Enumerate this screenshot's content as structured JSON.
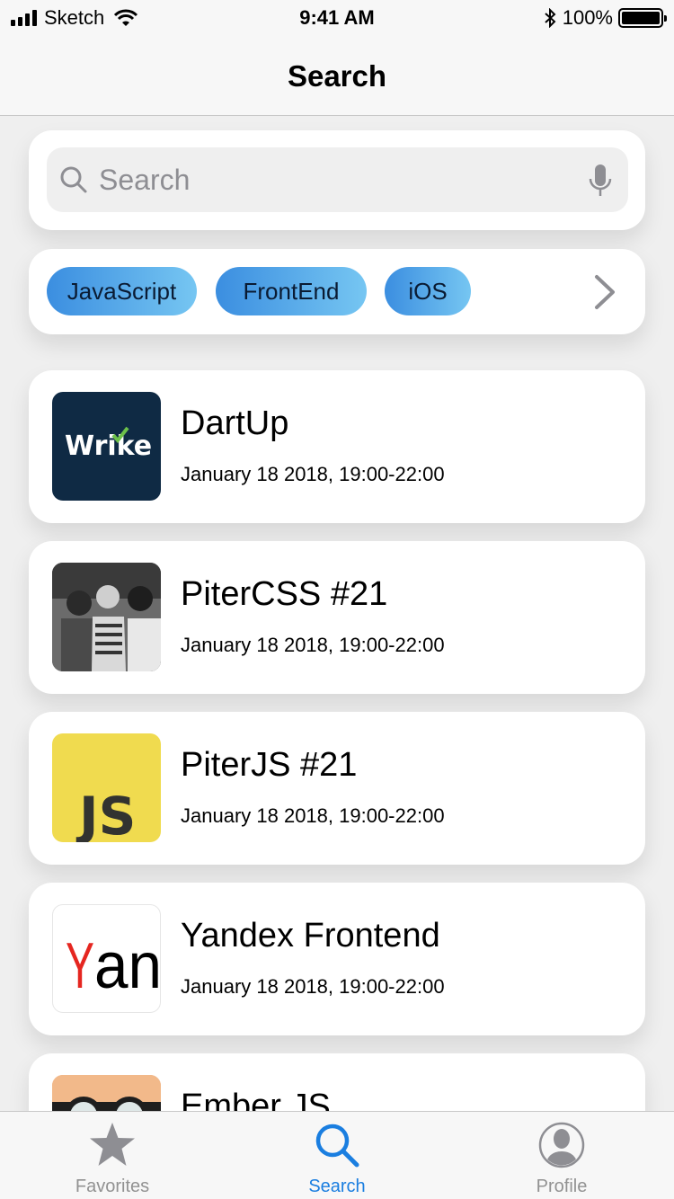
{
  "status_bar": {
    "carrier": "Sketch",
    "time": "9:41 AM",
    "battery": "100%"
  },
  "nav": {
    "title": "Search"
  },
  "search": {
    "placeholder": "Search"
  },
  "tags": [
    "JavaScript",
    "FrontEnd",
    "iOS"
  ],
  "events": [
    {
      "title": "DartUp",
      "date": "January 18 2018, 19:00-22:00",
      "thumb_icon": "wrike-logo",
      "thumb_text": "Wrike"
    },
    {
      "title": "PiterCSS #21",
      "date": "January 18 2018, 19:00-22:00",
      "thumb_icon": "audience-photo"
    },
    {
      "title": "PiterJS #21",
      "date": "January 18 2018, 19:00-22:00",
      "thumb_icon": "js-logo",
      "thumb_text": "JS"
    },
    {
      "title": "Yandex Frontend",
      "date": "January 18 2018, 19:00-22:00",
      "thumb_icon": "yandex-logo",
      "thumb_text": "Yan"
    },
    {
      "title": "Ember JS",
      "date": "",
      "thumb_icon": "ember-illustration"
    }
  ],
  "tab_bar": {
    "items": [
      {
        "label": "Favorites",
        "icon": "star-icon",
        "active": false
      },
      {
        "label": "Search",
        "icon": "search-icon",
        "active": true
      },
      {
        "label": "Profile",
        "icon": "profile-icon",
        "active": false
      }
    ]
  },
  "colors": {
    "accent": "#1a7ee0",
    "tag_gradient_start": "#3b8ee0",
    "tag_gradient_end": "#76c6f2",
    "wrike_bg": "#0f2a44",
    "js_bg": "#f0db4f",
    "yandex_red": "#e52620"
  }
}
